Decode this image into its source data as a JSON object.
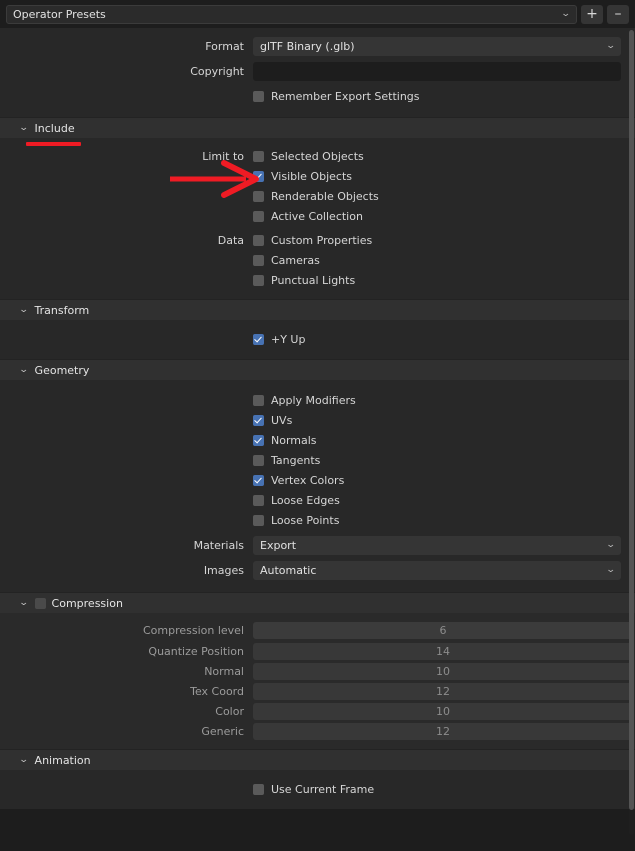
{
  "preset_bar": {
    "value": "Operator Presets",
    "add_label": "+",
    "remove_label": "–",
    "chevron": "⌄"
  },
  "top": {
    "format": {
      "label": "Format",
      "value": "glTF Binary (.glb)"
    },
    "copyright": {
      "label": "Copyright",
      "value": ""
    },
    "remember": {
      "label": "Remember Export Settings",
      "checked": false
    }
  },
  "sections": [
    {
      "id": "include",
      "title": "Include",
      "has_checkbox": false,
      "groups": [
        {
          "label": "Limit to",
          "items": [
            {
              "label": "Selected Objects",
              "checked": false
            },
            {
              "label": "Visible Objects",
              "checked": true
            },
            {
              "label": "Renderable Objects",
              "checked": false
            },
            {
              "label": "Active Collection",
              "checked": false
            }
          ]
        },
        {
          "label": "Data",
          "items": [
            {
              "label": "Custom Properties",
              "checked": false
            },
            {
              "label": "Cameras",
              "checked": false
            },
            {
              "label": "Punctual Lights",
              "checked": false
            }
          ]
        }
      ]
    },
    {
      "id": "transform",
      "title": "Transform",
      "has_checkbox": false,
      "groups": [
        {
          "label": "",
          "items": [
            {
              "label": "+Y Up",
              "checked": true
            }
          ]
        }
      ]
    },
    {
      "id": "geometry",
      "title": "Geometry",
      "has_checkbox": false,
      "groups": [
        {
          "label": "",
          "items": [
            {
              "label": "Apply Modifiers",
              "checked": false
            },
            {
              "label": "UVs",
              "checked": true
            },
            {
              "label": "Normals",
              "checked": true
            },
            {
              "label": "Tangents",
              "checked": false
            },
            {
              "label": "Vertex Colors",
              "checked": true
            },
            {
              "label": "Loose Edges",
              "checked": false
            },
            {
              "label": "Loose Points",
              "checked": false
            }
          ]
        }
      ],
      "dropdowns": [
        {
          "label": "Materials",
          "value": "Export"
        },
        {
          "label": "Images",
          "value": "Automatic"
        }
      ]
    },
    {
      "id": "compression",
      "title": "Compression",
      "has_checkbox": true,
      "checked": false,
      "sliders": [
        {
          "label": "Compression level",
          "value": "6"
        },
        {
          "label": "Quantize Position",
          "value": "14"
        },
        {
          "label": "Normal",
          "value": "10"
        },
        {
          "label": "Tex Coord",
          "value": "12"
        },
        {
          "label": "Color",
          "value": "10"
        },
        {
          "label": "Generic",
          "value": "12"
        }
      ]
    },
    {
      "id": "animation",
      "title": "Animation",
      "has_checkbox": false,
      "groups": [
        {
          "label": "",
          "items": [
            {
              "label": "Use Current Frame",
              "checked": false
            }
          ]
        }
      ]
    }
  ],
  "annotations": {
    "underline_color": "#ef1b24",
    "arrow_color": "#ef1b24",
    "underline_target": "Include",
    "arrow_target": "Visible Objects"
  }
}
